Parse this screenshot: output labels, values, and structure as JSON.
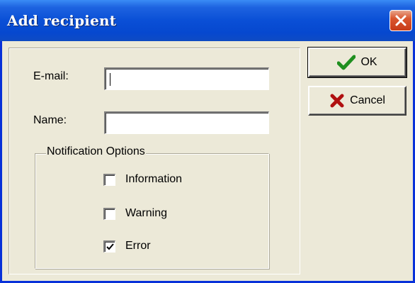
{
  "window": {
    "title": "Add recipient"
  },
  "form": {
    "email_label": "E-mail:",
    "email_value": "",
    "name_label": "Name:",
    "name_value": ""
  },
  "notification_options": {
    "legend": "Notification Options",
    "items": [
      {
        "label": "Information",
        "checked": false
      },
      {
        "label": "Warning",
        "checked": false
      },
      {
        "label": "Error",
        "checked": true
      }
    ]
  },
  "buttons": {
    "ok_label": "OK",
    "ok_icon": "checkmark-icon",
    "cancel_label": "Cancel",
    "cancel_icon": "x-icon"
  },
  "colors": {
    "titlebar": "#0a4fd6",
    "dialog_background": "#ece9d8",
    "ok_icon": "#1f8f1f",
    "cancel_icon": "#b01010"
  }
}
